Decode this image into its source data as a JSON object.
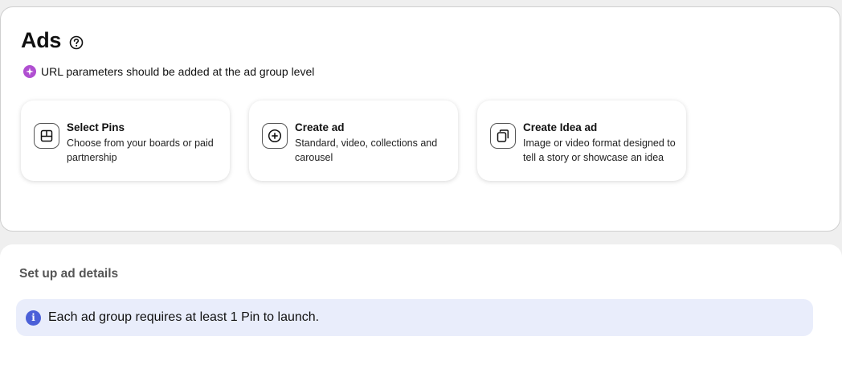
{
  "ads_section": {
    "title": "Ads",
    "help_icon": "help-circle-icon",
    "notice": {
      "icon": "sparkle-badge-icon",
      "icon_color": "#b04fd1",
      "text": "URL parameters should be added at the ad group level"
    },
    "options": [
      {
        "icon": "select-pins-icon",
        "title": "Select Pins",
        "description": "Choose from your boards or paid partnership"
      },
      {
        "icon": "plus-circle-icon",
        "title": "Create ad",
        "description": "Standard, video, collections and carousel"
      },
      {
        "icon": "idea-pin-icon",
        "title": "Create Idea ad",
        "description": "Image or video format designed to tell a story or showcase an idea"
      }
    ]
  },
  "details_section": {
    "title": "Set up ad details",
    "info_banner": {
      "icon": "info-icon",
      "icon_color": "#4b60d8",
      "text": "Each ad group requires at least 1 Pin to launch."
    }
  }
}
